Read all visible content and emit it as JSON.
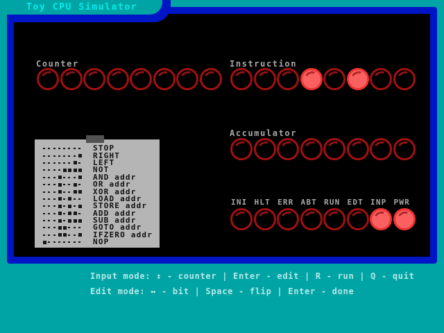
{
  "window": {
    "title": "Toy CPU Simulator"
  },
  "registers": [
    {
      "id": "counter",
      "label": "Counter",
      "bits": [
        0,
        0,
        0,
        0,
        0,
        0,
        0,
        0
      ]
    },
    {
      "id": "instruction",
      "label": "Instruction",
      "bits": [
        0,
        0,
        0,
        1,
        0,
        1,
        0,
        0
      ]
    },
    {
      "id": "accumulator",
      "label": "Accumulator",
      "bits": [
        0,
        0,
        0,
        0,
        0,
        0,
        0,
        0
      ]
    }
  ],
  "status": {
    "labels": [
      "INI",
      "HLT",
      "ERR",
      "ABT",
      "RUN",
      "EDT",
      "INP",
      "PWR"
    ],
    "bits": [
      0,
      0,
      0,
      0,
      0,
      0,
      1,
      1
    ]
  },
  "legend": {
    "items": [
      {
        "pattern": "00000000",
        "name": "STOP"
      },
      {
        "pattern": "00000001",
        "name": "RIGHT"
      },
      {
        "pattern": "00000010",
        "name": "LEFT"
      },
      {
        "pattern": "00001111",
        "name": "NOT"
      },
      {
        "pattern": "00010001",
        "name": "AND addr"
      },
      {
        "pattern": "00010010",
        "name": "OR addr"
      },
      {
        "pattern": "00010011",
        "name": "XOR addr"
      },
      {
        "pattern": "00010100",
        "name": "LOAD addr"
      },
      {
        "pattern": "00010101",
        "name": "STORE addr"
      },
      {
        "pattern": "00010110",
        "name": "ADD addr"
      },
      {
        "pattern": "00010111",
        "name": "SUB addr"
      },
      {
        "pattern": "00011000",
        "name": "GOTO addr"
      },
      {
        "pattern": "00011001",
        "name": "IFZERO addr"
      },
      {
        "pattern": "10000000",
        "name": "NOP"
      }
    ]
  },
  "help": {
    "line1": "Input mode: ↕ - counter | Enter - edit | R - run | Q - quit",
    "line2": "Edit mode: ↔ - bit | Space - flip | Enter - done"
  },
  "colors": {
    "background_teal": "#00a4a4",
    "panel_border_blue": "#0016c6",
    "panel_black": "#000000",
    "title_cyan": "#00ecec",
    "label_gray": "#a8a8a8",
    "led_on_fill": "#fa6060",
    "led_on_ring": "#ee3232",
    "led_off_ring": "#a31111",
    "legend_bg_gray": "#b5b5b5",
    "help_text": "#b5e9e9"
  }
}
